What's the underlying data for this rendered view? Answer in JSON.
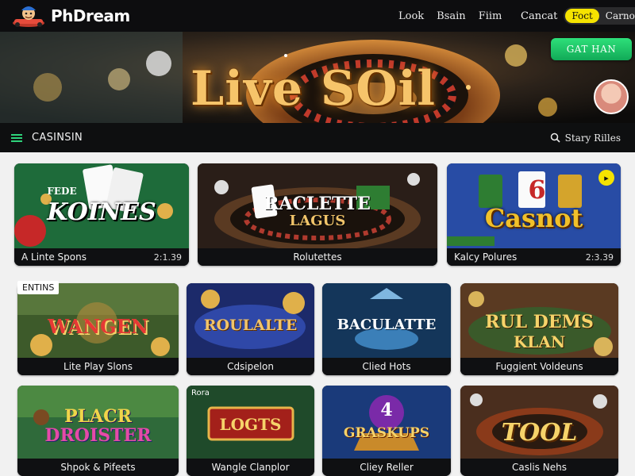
{
  "header": {
    "brand": "PhDream",
    "nav": [
      "Look",
      "Bsain",
      "Fiim"
    ],
    "contact": "Cancat",
    "pill_primary": "Foct",
    "pill_secondary": "Carno"
  },
  "hero": {
    "title": "Live SOil",
    "cta": "GAT HAN"
  },
  "category_bar": {
    "title": "CASINSIN",
    "search_label": "Stary Rilles"
  },
  "section": {
    "label": "ENTINS"
  },
  "cards_row1": [
    {
      "art_title": "KOINES",
      "art_kicker": "FEDE",
      "caption": "A Linte Spons",
      "time": "2:1.39"
    },
    {
      "art_title": "RACLETTE",
      "art_sub": "LAGUS",
      "caption": "Rolutettes",
      "time": ""
    },
    {
      "art_title": "Casnot",
      "art_kicker": "6",
      "caption": "Kalcy Polures",
      "time": "2:3.39"
    }
  ],
  "cards_row2": [
    {
      "art_title": "WANGEN",
      "caption": "Lite Play Slons"
    },
    {
      "art_title": "ROULALTE",
      "caption": "Cdsipelon"
    },
    {
      "art_title": "BACULATTE",
      "caption": "Clied Hots"
    },
    {
      "art_title": "RUL DEMS",
      "art_sub": "KLAN",
      "caption": "Fuggient Voldeuns"
    }
  ],
  "cards_row3": [
    {
      "art_title": "PLACR",
      "art_sub": "DROISTER",
      "caption": "Shpok & Pifeets",
      "tag": ""
    },
    {
      "art_title": "LOGTS",
      "caption": "Wangle Clanplor",
      "tag": "Rora"
    },
    {
      "art_title": "GRASKUPS",
      "art_kicker": "4",
      "caption": "Cliey Reller"
    },
    {
      "art_title": "TOOL",
      "caption": "Caslis Nehs"
    }
  ],
  "colors": {
    "accent_green": "#11a957",
    "accent_yellow": "#f5e300",
    "dark": "#0e0f10"
  }
}
